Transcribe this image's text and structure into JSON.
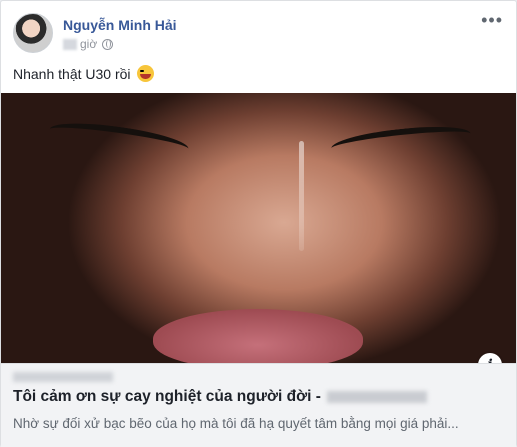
{
  "post": {
    "author": "Nguyễn Minh Hải",
    "time_suffix": "giờ",
    "caption": "Nhanh thật U30 rồi",
    "more": "•••"
  },
  "link": {
    "title": "Tôi cảm ơn sự cay nghiệt của người đời -",
    "description": "Nhờ sự đối xử bạc bẽo của họ mà tôi đã hạ quyết tâm bằng mọi giá phải...",
    "info": "i"
  }
}
